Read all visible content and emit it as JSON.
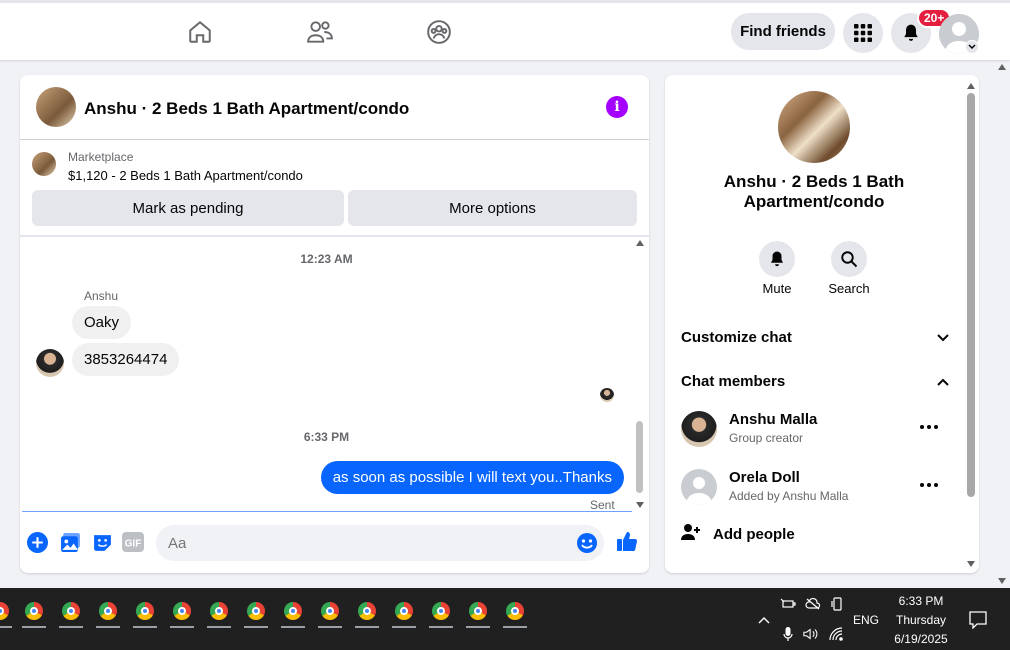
{
  "nav": {
    "find_friends": "Find friends",
    "notif_count": "20+",
    "icons": [
      "home-icon",
      "friends-icon",
      "groups-icon",
      "menu-grid-icon",
      "bell-icon"
    ]
  },
  "chat": {
    "title": "Anshu · 2 Beds 1 Bath Apartment/condo",
    "marketplace_label": "Marketplace",
    "listing": "$1,120 - 2 Beds 1 Bath Apartment/condo",
    "mark_pending": "Mark as pending",
    "more_options": "More options",
    "time1": "12:23 AM",
    "sender": "Anshu",
    "messages_in": [
      "Oaky",
      "3853264474"
    ],
    "time2": "6:33 PM",
    "message_out": "as soon as possible I will text you..Thanks",
    "sent_status": "Sent",
    "input_placeholder": "Aa",
    "gif_label": "GIF"
  },
  "info": {
    "title": "Anshu · 2 Beds 1 Bath Apartment/condo",
    "mute": "Mute",
    "search": "Search",
    "customize_chat": "Customize chat",
    "chat_members": "Chat members",
    "members": [
      {
        "name": "Anshu Malla",
        "role": "Group creator"
      },
      {
        "name": "Orela Doll",
        "role": "Added by Anshu Malla"
      }
    ],
    "add_people": "Add people"
  },
  "taskbar": {
    "lang": "ENG",
    "time": "6:33 PM",
    "day": "Thursday",
    "date": "6/19/2025"
  },
  "colors": {
    "accent": "#0866ff",
    "info": "#a400ff",
    "badge": "#e41e3f"
  }
}
